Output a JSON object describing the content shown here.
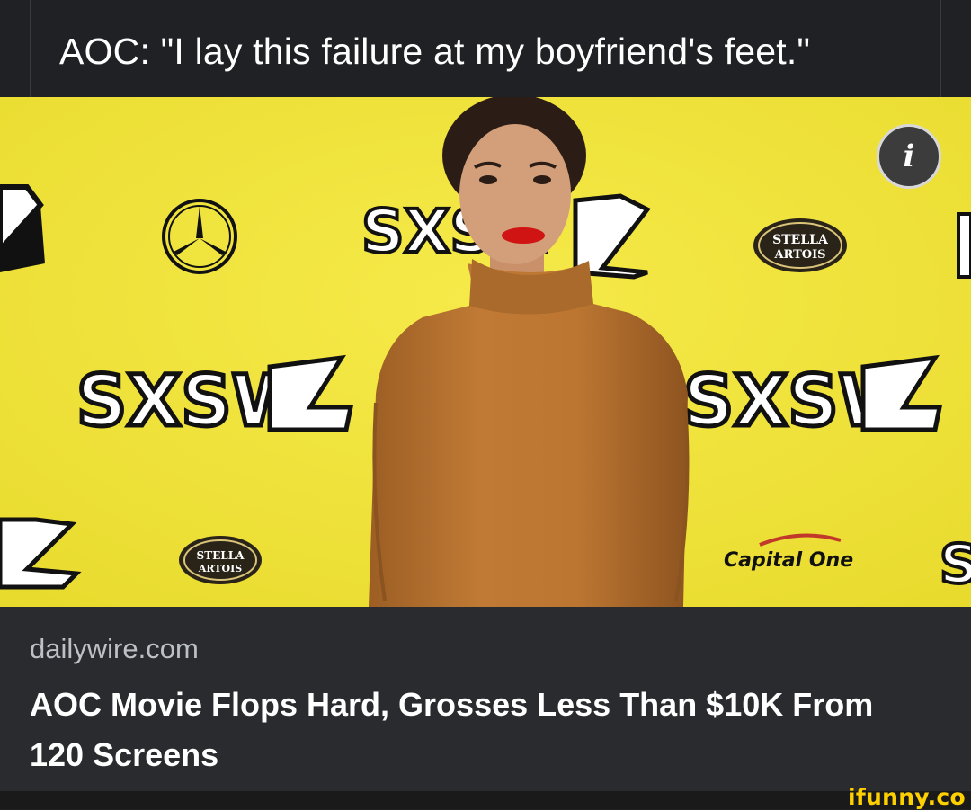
{
  "caption": {
    "text": "AOC: \"I lay this failure at my boyfriend's feet.\""
  },
  "card": {
    "info_glyph": "i",
    "source": "dailywire.com",
    "headline": "AOC Movie Flops Hard, Grosses Less Than $10K From 120 Screens",
    "photo": {
      "logos": {
        "sxsw": "SXSW",
        "stella_line1": "STELLA",
        "stella_line2": "ARTOIS",
        "capital_one": "Capital One"
      },
      "colors": {
        "backdrop": "#f0e436",
        "turtleneck": "#b8742f"
      }
    }
  },
  "watermark": "ifunny.co"
}
